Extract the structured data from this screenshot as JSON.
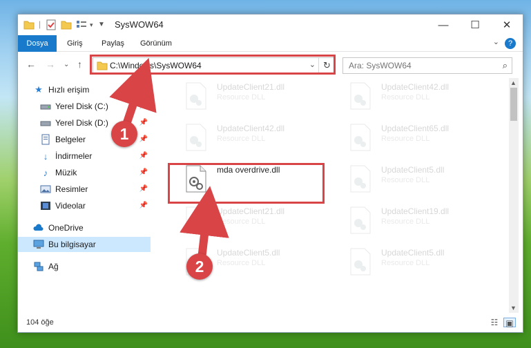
{
  "window": {
    "title": "SysWOW64"
  },
  "ribbon": {
    "tabs": [
      "Dosya",
      "Giriş",
      "Paylaş",
      "Görünüm"
    ],
    "help": "?"
  },
  "navbar": {
    "address": "C:\\Windows\\SysWOW64",
    "search_placeholder": "Ara: SysWOW64"
  },
  "sidebar": {
    "quick_access": "Hızlı erişim",
    "items": [
      {
        "label": "Yerel Disk (C:)",
        "icon": "drive-icon"
      },
      {
        "label": "Yerel Disk (D:)",
        "icon": "drive-icon"
      },
      {
        "label": "Belgeler",
        "icon": "documents-icon"
      },
      {
        "label": "İndirmeler",
        "icon": "download-icon"
      },
      {
        "label": "Müzik",
        "icon": "music-icon"
      },
      {
        "label": "Resimler",
        "icon": "pictures-icon"
      },
      {
        "label": "Videolar",
        "icon": "video-icon"
      }
    ],
    "onedrive": "OneDrive",
    "this_pc": "Bu bilgisayar",
    "network": "Ağ"
  },
  "files": {
    "left": [
      {
        "name": "UpdateClient21.dll",
        "type": "Resource DLL"
      },
      {
        "name": "UpdateClient42.dll",
        "type": "Resource DLL"
      },
      {
        "name": "mda overdrive.dll",
        "type": ""
      },
      {
        "name": "UpdateClient21.dll",
        "type": "Resource DLL"
      },
      {
        "name": "UpdateClient5.dll",
        "type": "Resource DLL"
      }
    ],
    "right": [
      {
        "name": "UpdateClient42.dll",
        "type": "Resource DLL"
      },
      {
        "name": "UpdateClient65.dll",
        "type": "Resource DLL"
      },
      {
        "name": "UpdateClient5.dll",
        "type": "Resource DLL"
      },
      {
        "name": "UpdateClient19.dll",
        "type": "Resource DLL"
      },
      {
        "name": "UpdateClient5.dll",
        "type": "Resource DLL"
      }
    ]
  },
  "status": {
    "count": "104 öğe"
  },
  "annotations": {
    "step1": "1",
    "step2": "2"
  },
  "colors": {
    "accent": "#1979ca",
    "highlight": "#d94447",
    "selected": "#cce8ff"
  }
}
